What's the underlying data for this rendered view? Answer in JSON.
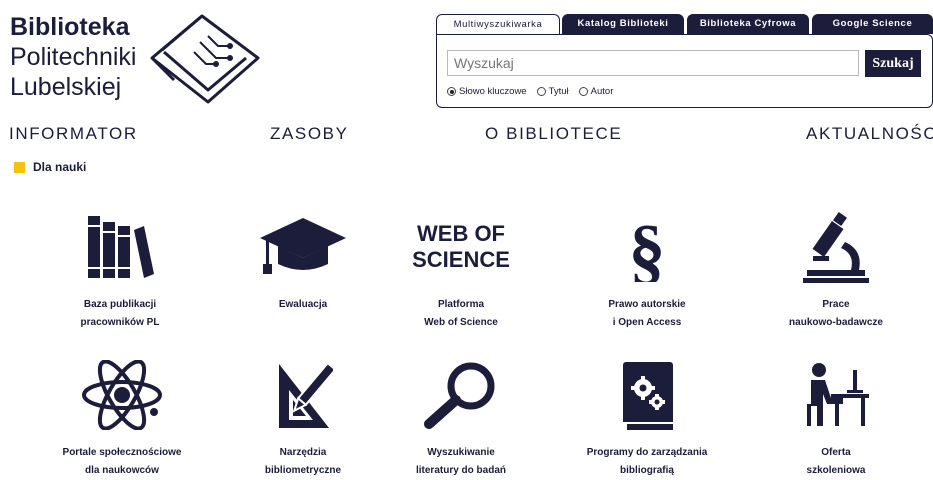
{
  "logo": {
    "line1": "Biblioteka",
    "line2": "Politechniki",
    "line3": "Lubelskiej"
  },
  "search": {
    "tabs": [
      {
        "label": "Multiwyszukiwarka",
        "active": true
      },
      {
        "label": "Katalog Biblioteki",
        "active": false
      },
      {
        "label": "Biblioteka Cyfrowa",
        "active": false
      },
      {
        "label": "Google Science",
        "active": false
      }
    ],
    "placeholder": "Wyszukaj",
    "button_label": "Szukaj",
    "options": [
      {
        "label": "Słowo kluczowe",
        "checked": true
      },
      {
        "label": "Tytuł",
        "checked": false
      },
      {
        "label": "Autor",
        "checked": false
      }
    ]
  },
  "nav": {
    "items": [
      "INFORMATOR",
      "ZASOBY",
      "O BIBLIOTECE",
      "AKTUALNOŚCI"
    ]
  },
  "breadcrumb": {
    "label": "Dla nauki",
    "accent_color": "#f4c20d"
  },
  "tiles": [
    {
      "icon": "books-icon",
      "label": "Baza publikacji\npracowników PL"
    },
    {
      "icon": "graduation-cap-icon",
      "label": "Ewaluacja"
    },
    {
      "icon": "web-of-science-logo",
      "logo_line1": "WEB OF",
      "logo_line2": "SCIENCE",
      "label": "Platforma\nWeb of Science"
    },
    {
      "icon": "section-sign-icon",
      "label": "Prawo autorskie\ni Open Access"
    },
    {
      "icon": "microscope-icon",
      "label": "Prace\nnaukowo-badawcze"
    },
    {
      "icon": "atom-icon",
      "label": "Portale społecznościowe\ndla naukowców"
    },
    {
      "icon": "triangle-pencil-icon",
      "label": "Narzędzia\nbibliometryczne"
    },
    {
      "icon": "magnifier-icon",
      "label": "Wyszukiwanie\nliteratury do badań"
    },
    {
      "icon": "gear-book-icon",
      "label": "Programy do zarządzania\nbibliografią"
    },
    {
      "icon": "desk-person-icon",
      "label": "Oferta\nszkoleniowa"
    }
  ],
  "colors": {
    "primary": "#1c1c3b",
    "accent": "#f4c20d"
  }
}
